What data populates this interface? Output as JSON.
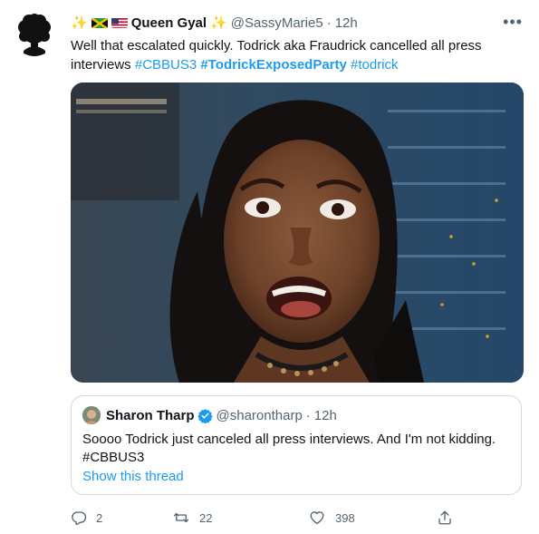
{
  "tweet": {
    "author_name": "Queen Gyal",
    "handle": "@SassyMarie5",
    "separator": "·",
    "time": "12h",
    "more_label": "•••",
    "text_plain": "Well that escalated quickly. Todrick aka Fraudrick cancelled all press interviews",
    "hashtags": [
      "#CBBUS3",
      "#TodrickExposedParty",
      "#todrick"
    ],
    "media_icon": "gif-reaction-image"
  },
  "quoted": {
    "author_name": "Sharon Tharp",
    "handle": "@sharontharp",
    "separator": "·",
    "time": "12h",
    "text": "Soooo Todrick just canceled all press interviews. And I'm not kidding.",
    "hashtag": "#CBBUS3",
    "link_label": "Show this thread"
  },
  "actions": {
    "reply_count": "2",
    "retweet_count": "22",
    "like_count": "398"
  },
  "colors": {
    "accent": "#1d9bf0",
    "muted": "#536471",
    "border": "#cfd9de"
  }
}
